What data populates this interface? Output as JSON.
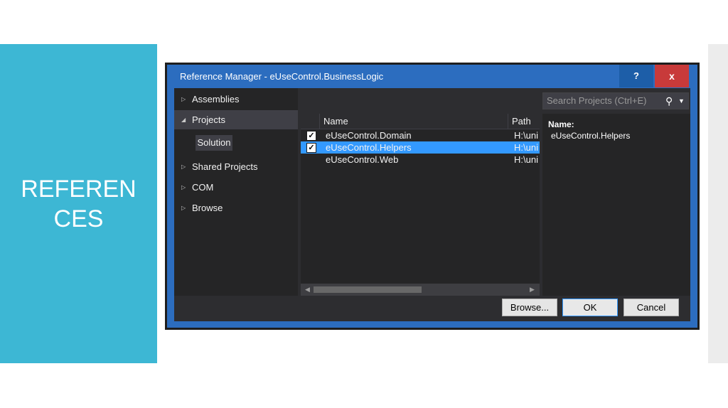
{
  "slide": {
    "title_line1": "REFEREN",
    "title_line2": "CES",
    "accent_color": "#3db7d4"
  },
  "window": {
    "title": "Reference Manager - eUseControl.BusinessLogic",
    "help_label": "?",
    "close_label": "x"
  },
  "nav": {
    "items": [
      {
        "label": "Assemblies",
        "expanded": false
      },
      {
        "label": "Projects",
        "expanded": true,
        "selected": true
      },
      {
        "label": "Solution",
        "sub": true
      },
      {
        "label": "Shared Projects",
        "expanded": false
      },
      {
        "label": "COM",
        "expanded": false
      },
      {
        "label": "Browse",
        "expanded": false
      }
    ]
  },
  "search": {
    "placeholder": "Search Projects (Ctrl+E)",
    "icon": "search-icon"
  },
  "list": {
    "columns": [
      "Name",
      "Path"
    ],
    "rows": [
      {
        "name": "eUseControl.Domain",
        "path": "H:\\uni",
        "checked": true,
        "selected": false
      },
      {
        "name": "eUseControl.Helpers",
        "path": "H:\\uni",
        "checked": true,
        "selected": true
      },
      {
        "name": "eUseControl.Web",
        "path": "H:\\uni",
        "checked": false,
        "selected": false
      }
    ]
  },
  "details": {
    "name_label": "Name:",
    "name_value": "eUseControl.Helpers"
  },
  "buttons": {
    "browse": "Browse...",
    "ok": "OK",
    "cancel": "Cancel"
  }
}
